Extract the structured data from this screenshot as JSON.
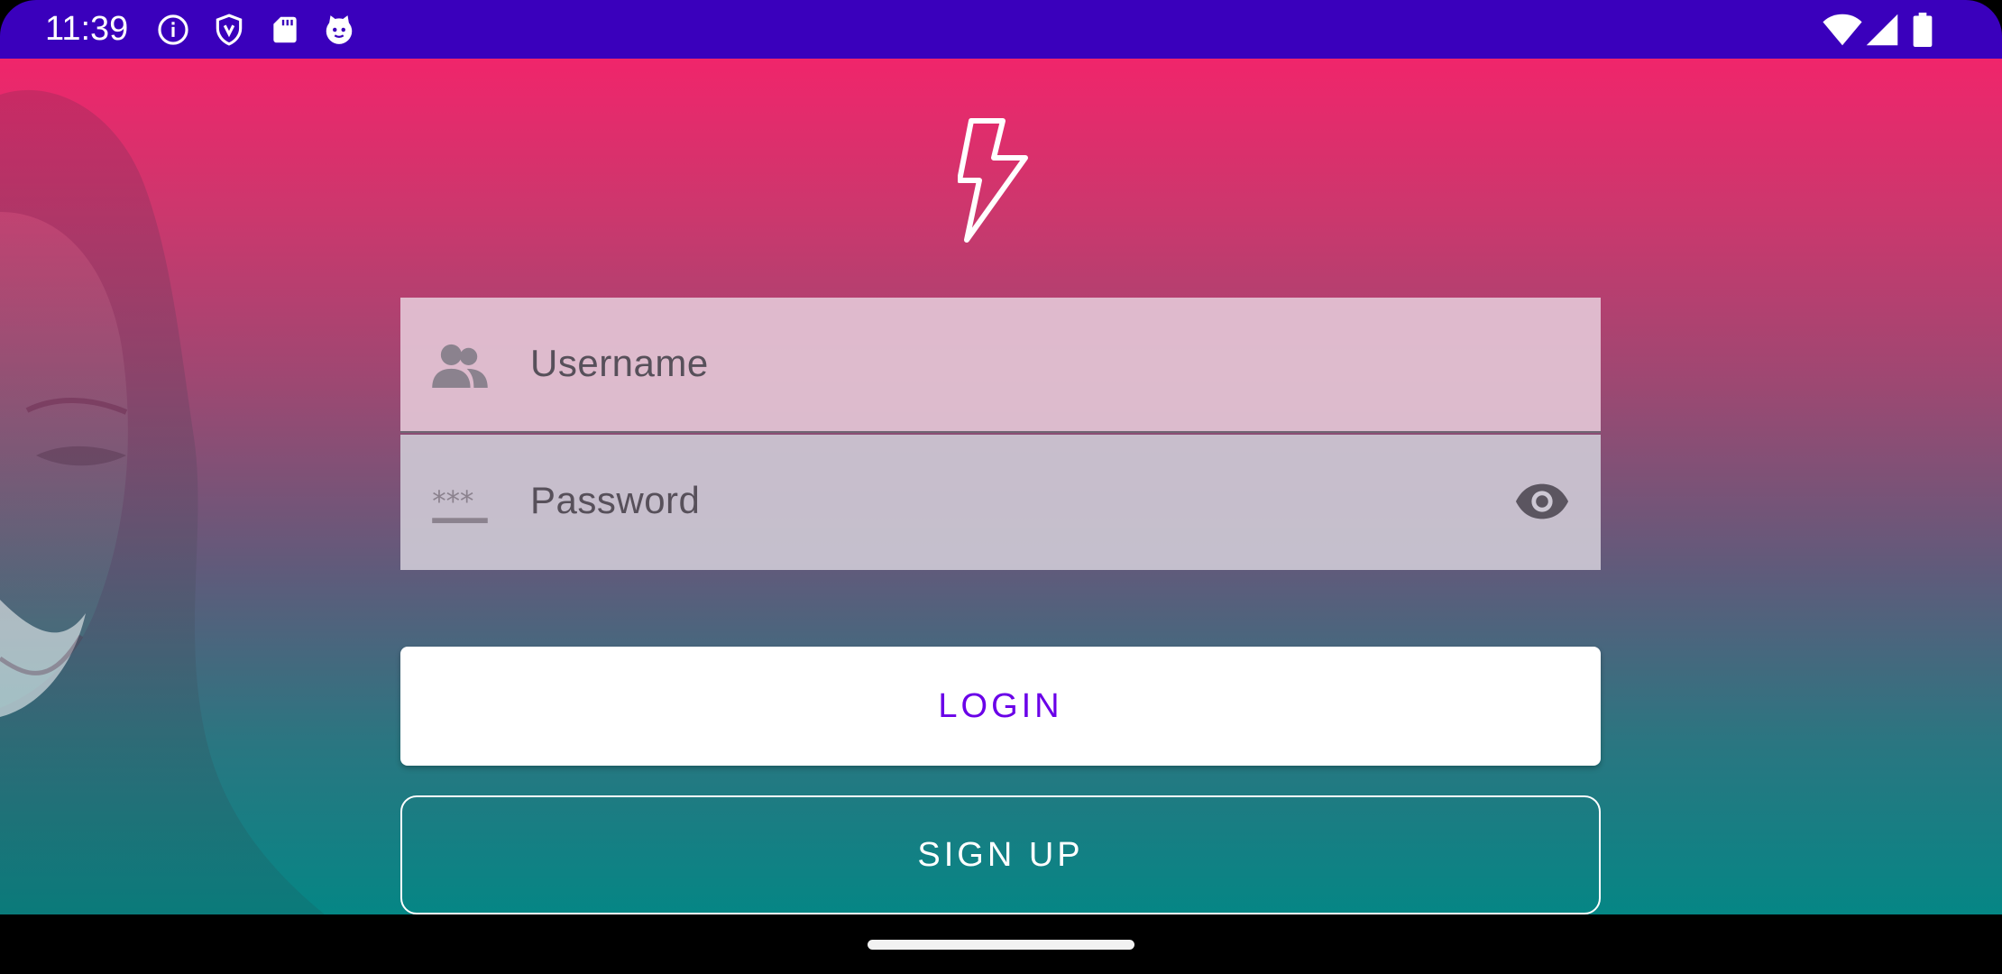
{
  "status_bar": {
    "time": "11:39",
    "icons": [
      "info-icon",
      "shield-icon",
      "sd-card-icon",
      "cat-icon"
    ],
    "right_icons": [
      "wifi-icon",
      "signal-icon",
      "battery-icon"
    ],
    "background": "#3a00bc"
  },
  "login_form": {
    "logo": "lightning-bolt-icon",
    "username": {
      "placeholder": "Username",
      "icon": "people-icon"
    },
    "password": {
      "placeholder": "Password",
      "icon": "password-icon",
      "toggle_icon": "eye-icon"
    },
    "login_label": "LOGIN",
    "signup_label": "SIGN UP"
  },
  "colors": {
    "gradient_top": "#f0256b",
    "gradient_bottom": "#058685",
    "login_text": "#6a00e8"
  }
}
